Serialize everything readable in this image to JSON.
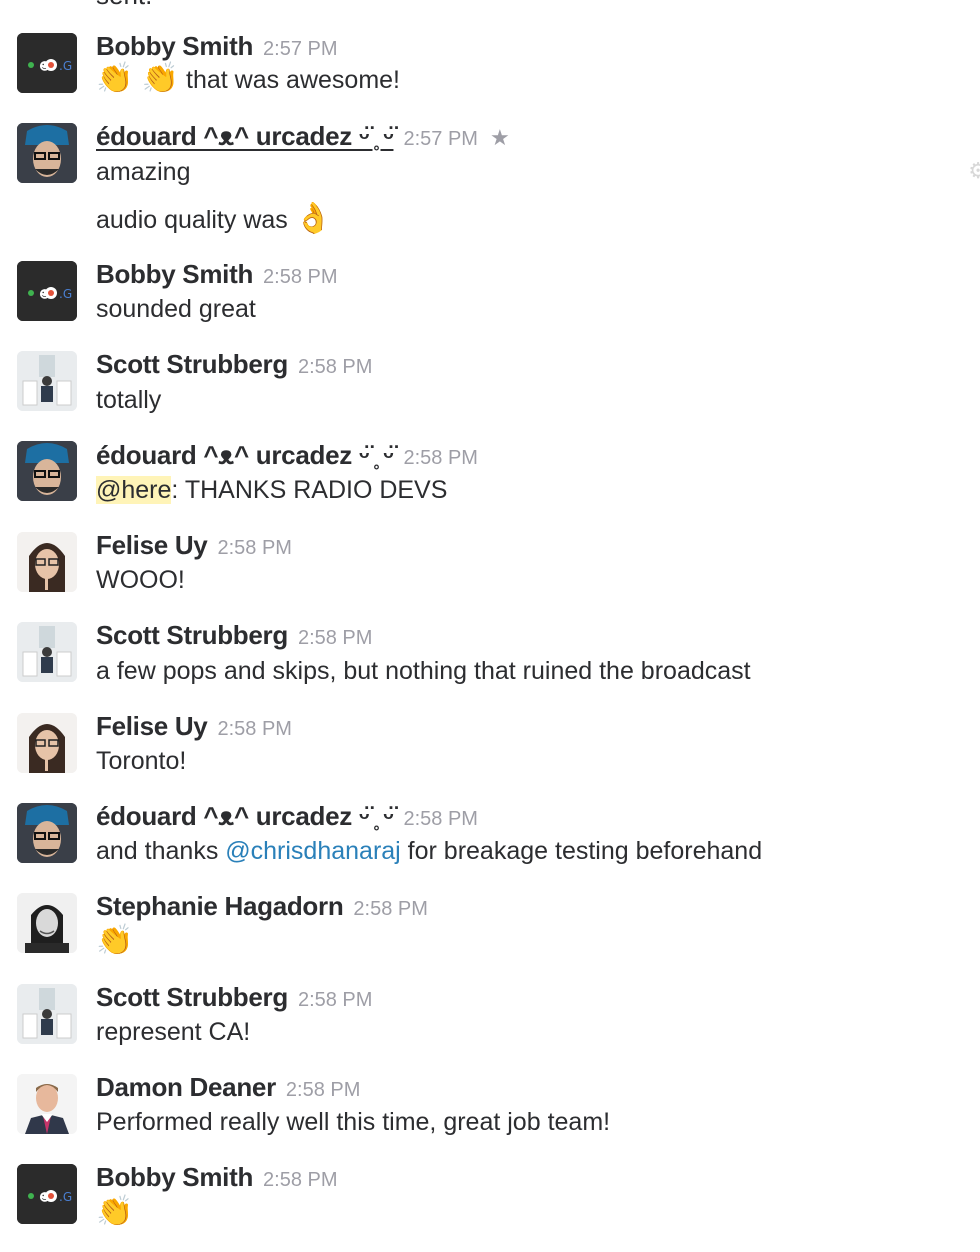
{
  "top_cutoff_text": "sent.",
  "messages": [
    {
      "author": "Bobby Smith",
      "avatar": "bobby",
      "time": "2:57 PM",
      "lines": [
        {
          "emoji": "👏 👏",
          "text": "that was awesome!"
        }
      ]
    },
    {
      "author": "édouard ^ᴥ^ urcadez ᵕ̈ ̥ ᵕ̈",
      "avatar": "edouard",
      "time": "2:57 PM",
      "starred": true,
      "underlined": true,
      "lines": [
        {
          "text": "amazing"
        },
        {
          "text": "audio quality was",
          "emoji_after": "👌"
        }
      ]
    },
    {
      "author": "Bobby Smith",
      "avatar": "bobby",
      "time": "2:58 PM",
      "lines": [
        {
          "text": "sounded great"
        }
      ]
    },
    {
      "author": "Scott Strubberg",
      "avatar": "scott",
      "time": "2:58 PM",
      "lines": [
        {
          "text": "totally"
        }
      ]
    },
    {
      "author": "édouard ^ᴥ^ urcadez ᵕ̈ ̥ ᵕ̈",
      "avatar": "edouard",
      "time": "2:58 PM",
      "lines": [
        {
          "mention": "@here",
          "text": ": THANKS RADIO DEVS"
        }
      ]
    },
    {
      "author": "Felise Uy",
      "avatar": "felise",
      "time": "2:58 PM",
      "lines": [
        {
          "text": "WOOO!"
        }
      ]
    },
    {
      "author": "Scott Strubberg",
      "avatar": "scott",
      "time": "2:58 PM",
      "lines": [
        {
          "text": "a few pops and skips, but nothing that ruined the broadcast"
        }
      ]
    },
    {
      "author": "Felise Uy",
      "avatar": "felise",
      "time": "2:58 PM",
      "lines": [
        {
          "text": "Toronto!"
        }
      ]
    },
    {
      "author": "édouard ^ᴥ^ urcadez ᵕ̈ ̥ ᵕ̈",
      "avatar": "edouard",
      "time": "2:58 PM",
      "lines": [
        {
          "text_before": "and thanks ",
          "link": "@chrisdhanaraj",
          "text": " for breakage testing beforehand"
        }
      ]
    },
    {
      "author": "Stephanie Hagadorn",
      "avatar": "steph",
      "time": "2:58 PM",
      "lines": [
        {
          "emoji": "👏"
        }
      ]
    },
    {
      "author": "Scott Strubberg",
      "avatar": "scott",
      "time": "2:58 PM",
      "lines": [
        {
          "text": "represent CA!"
        }
      ]
    },
    {
      "author": "Damon Deaner",
      "avatar": "damon",
      "time": "2:58 PM",
      "lines": [
        {
          "text": "Performed really well this time, great job team!"
        }
      ]
    },
    {
      "author": "Bobby Smith",
      "avatar": "bobby",
      "time": "2:58 PM",
      "lines": [
        {
          "emoji": "👏"
        }
      ]
    }
  ],
  "icons": {
    "star": "star-icon",
    "gear": "gear-icon"
  },
  "colors": {
    "text": "#2c2d30",
    "timestamp": "#9e9ea6",
    "link": "#2a80b9",
    "mention_bg": "#fff4b8"
  }
}
